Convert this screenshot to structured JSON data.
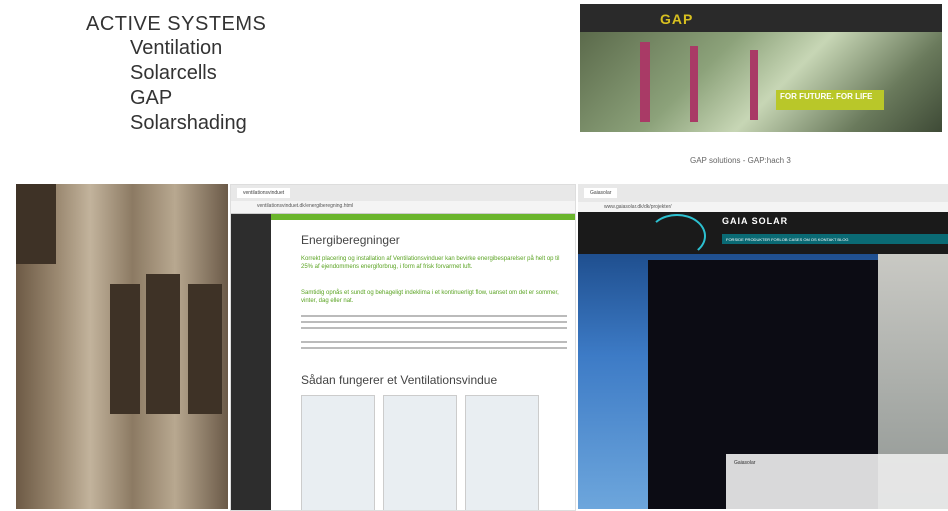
{
  "title": "ACTIVE SYSTEMS",
  "systems": [
    "Ventilation",
    "Solarcells",
    "GAP",
    "Solarshading"
  ],
  "gap_site": {
    "logo": "GAP",
    "tagline": "FOR FUTURE. FOR LIFE",
    "caption": "GAP solutions - GAP:hach 3"
  },
  "vent_site": {
    "tab": "ventilationsvinduet",
    "url": "ventilationsvinduet.dk/energiberegning.html",
    "heading": "Energiberegninger",
    "green_text_1": "Korrekt placering og installation af Ventilationsvinduer kan bevirke energibesparelser på helt op til 25% af ejendommens energiforbrug, i form af frisk forvarmet luft.",
    "green_text_2": "Samtidig opnås et sundt og behageligt indeklima i et kontinuerligt flow, uanset om det er sommer, vinter, dag eller nat.",
    "subheading": "Sådan fungerer et Ventilationsvindue"
  },
  "gaia_site": {
    "tab": "Gaiasolar",
    "url": "www.gaiasolar.dk/dk/projekter/",
    "title": "GAIA SOLAR",
    "nav": "FORSIDE   PRODUKTER   FORLOB   CASES   OM OS   KONTAKT   BLOG",
    "info_title": "Gaiasolar"
  }
}
